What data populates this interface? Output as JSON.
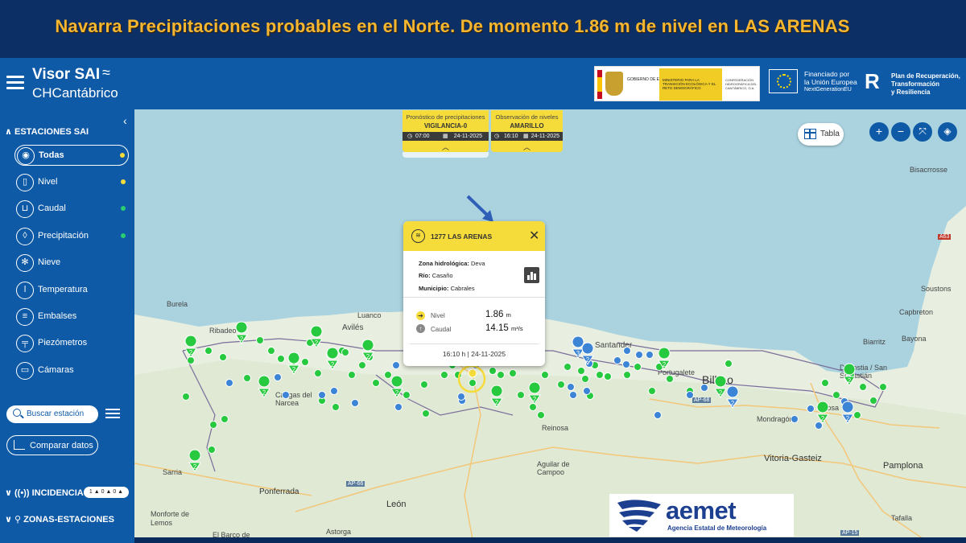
{
  "banner": {
    "text": "Navarra Precipitaciones probables en el Norte. De momento 1.86 m de nivel en LAS ARENAS"
  },
  "app": {
    "title": "Visor SAI",
    "subtitle": "CHCantábrico"
  },
  "header_logos": {
    "gov_line1": "GOBIERNO DE ESPAÑA",
    "gov_line2": "MINISTERIO PARA LA TRANSICIÓN ECOLÓGICA Y EL RETO DEMOGRÁFICO",
    "gov_line3": "CONFEDERACIÓN HIDROGRÁFICA DEL CANTÁBRICO, O.A.",
    "eu_line1": "Financiado por",
    "eu_line2": "la Unión Europea",
    "eu_line3": "NextGenerationEU",
    "prtr_line1": "Plan de Recuperación,",
    "prtr_line2": "Transformación",
    "prtr_line3": "y Resiliencia"
  },
  "sidebar": {
    "stations_header": "ESTACIONES SAI",
    "items": [
      {
        "label": "Todas",
        "icon": "broadcast-icon",
        "dot_color": "#f6dc3a"
      },
      {
        "label": "Nivel",
        "icon": "gauge-icon",
        "dot_color": "#f6dc3a"
      },
      {
        "label": "Caudal",
        "icon": "flow-icon",
        "dot_color": "#2ecc71"
      },
      {
        "label": "Precipitación",
        "icon": "drop-icon",
        "dot_color": "#2ecc71"
      },
      {
        "label": "Nieve",
        "icon": "snowflake-icon",
        "dot_color": ""
      },
      {
        "label": "Temperatura",
        "icon": "thermometer-icon",
        "dot_color": ""
      },
      {
        "label": "Embalses",
        "icon": "dam-icon",
        "dot_color": ""
      },
      {
        "label": "Piezómetros",
        "icon": "well-icon",
        "dot_color": ""
      },
      {
        "label": "Cámaras",
        "icon": "camera-icon",
        "dot_color": ""
      }
    ],
    "search_placeholder": "Buscar estación",
    "compare_label": "Comparar datos",
    "incidents_header": "INCIDENCIAS",
    "incident_badges": "1 ▲ 0 ▲ 0 ▲",
    "zones_header": "ZONAS-ESTACIONES"
  },
  "cards": {
    "forecast": {
      "title": "Pronóstico de precipitaciones",
      "level": "VIGILANCIA-0",
      "time": "07:00",
      "date": "24-11-2025"
    },
    "observation": {
      "title": "Observación de niveles",
      "level": "AMARILLO",
      "time": "16:10",
      "date": "24-11-2025"
    }
  },
  "map_controls": {
    "table_label": "Tabla",
    "zoom_in": "+",
    "zoom_out": "−"
  },
  "popup": {
    "title": "1277 LAS ARENAS",
    "zona_label": "Zona hidrológica:",
    "zona_value": "Deva",
    "rio_label": "Río:",
    "rio_value": "Casaño",
    "municipio_label": "Municipio:",
    "municipio_value": "Cabrales",
    "nivel_label": "Nivel",
    "nivel_value": "1.86",
    "nivel_unit": "m",
    "caudal_label": "Caudal",
    "caudal_value": "14.15",
    "caudal_unit": "m³/s",
    "timestamp": "16:10 h | 24-11-2025"
  },
  "map_labels": [
    {
      "text": "Bilbao"
    },
    {
      "text": "Burela"
    },
    {
      "text": "Luanco"
    },
    {
      "text": "Avilés"
    },
    {
      "text": "Ribadeo"
    },
    {
      "text": "Cangas del Narcea"
    },
    {
      "text": "Santander"
    },
    {
      "text": "Portugalete"
    },
    {
      "text": "Donostia / San Sebastián"
    },
    {
      "text": "Biarritz"
    },
    {
      "text": "Bayona"
    },
    {
      "text": "Capbreton"
    },
    {
      "text": "Soustons"
    },
    {
      "text": "Bisacrrosse"
    },
    {
      "text": "Vitoria-Gasteiz"
    },
    {
      "text": "Pamplona"
    },
    {
      "text": "Reinosa"
    },
    {
      "text": "León"
    },
    {
      "text": "Aguilar de Campoo"
    },
    {
      "text": "Ponferrada"
    },
    {
      "text": "Monforte de Lemos"
    },
    {
      "text": "Sarria"
    },
    {
      "text": "Astorga"
    },
    {
      "text": "El Barco de"
    },
    {
      "text": "Tafalla"
    },
    {
      "text": "Mondragón"
    },
    {
      "text": "Tolosa"
    }
  ],
  "road_labels": [
    "AP-66",
    "AP-68",
    "AP-15",
    "A63"
  ],
  "aemet": {
    "wordmark": "aemet",
    "subtitle": "Agencia Estatal de Meteorología"
  },
  "colors": {
    "brand_blue": "#0e5aa7",
    "alert_yellow": "#f6dc3a",
    "station_green": "#27c93f",
    "station_blue": "#3b84d6",
    "sea": "#aad3df"
  }
}
